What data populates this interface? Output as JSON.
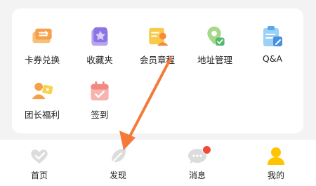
{
  "services": {
    "row1": [
      {
        "label": "卡券兑换",
        "icon": "coupon-ticket-icon"
      },
      {
        "label": "收藏夹",
        "icon": "favorites-star-icon"
      },
      {
        "label": "会员章程",
        "icon": "member-charter-icon"
      },
      {
        "label": "地址管理",
        "icon": "address-pin-icon"
      },
      {
        "label": "Q&A",
        "icon": "qa-clipboard-icon"
      }
    ],
    "row2": [
      {
        "label": "团长福利",
        "icon": "leader-benefits-icon"
      },
      {
        "label": "签到",
        "icon": "check-in-calendar-icon"
      }
    ]
  },
  "tabbar": {
    "items": [
      {
        "label": "首页",
        "icon": "home-heart-icon",
        "active": false
      },
      {
        "label": "发现",
        "icon": "discover-leaf-icon",
        "active": false
      },
      {
        "label": "消息",
        "icon": "message-bubble-icon",
        "active": false,
        "badge": true
      },
      {
        "label": "我的",
        "icon": "profile-person-icon",
        "active": true
      }
    ]
  },
  "colors": {
    "accent": "#ffc300",
    "arrow": "#f47a3a",
    "badge": "#f04a3a",
    "inactive_icon": "#dcdcdc"
  }
}
